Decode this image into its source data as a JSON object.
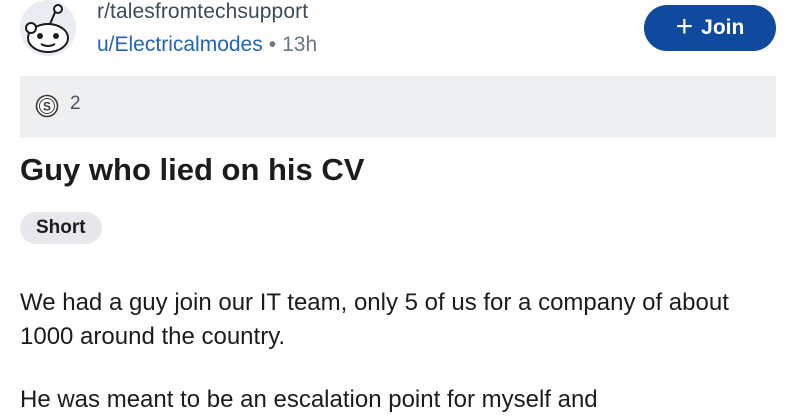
{
  "header": {
    "subreddit": "r/talesfromtechsupport",
    "username": "u/Electricalmodes",
    "separator": "•",
    "time_ago": "13h",
    "avatar_icon": "subreddit-avatar-icon"
  },
  "join_button": {
    "icon": "plus-icon",
    "icon_glyph": "+",
    "label": "Join"
  },
  "awards": {
    "icon": "award-icon",
    "count": "2"
  },
  "post": {
    "title": "Guy who lied on his CV",
    "flair": "Short",
    "paragraphs": [
      "We had a guy join our IT team, only 5 of us for a company of about 1000 around the country.",
      "He was meant to be an escalation point for myself and"
    ]
  },
  "colors": {
    "join_bg": "#0f4a9e",
    "username": "#2463b8",
    "award_bar_bg": "#eeeff1",
    "flair_bg": "#e6e8eb"
  }
}
